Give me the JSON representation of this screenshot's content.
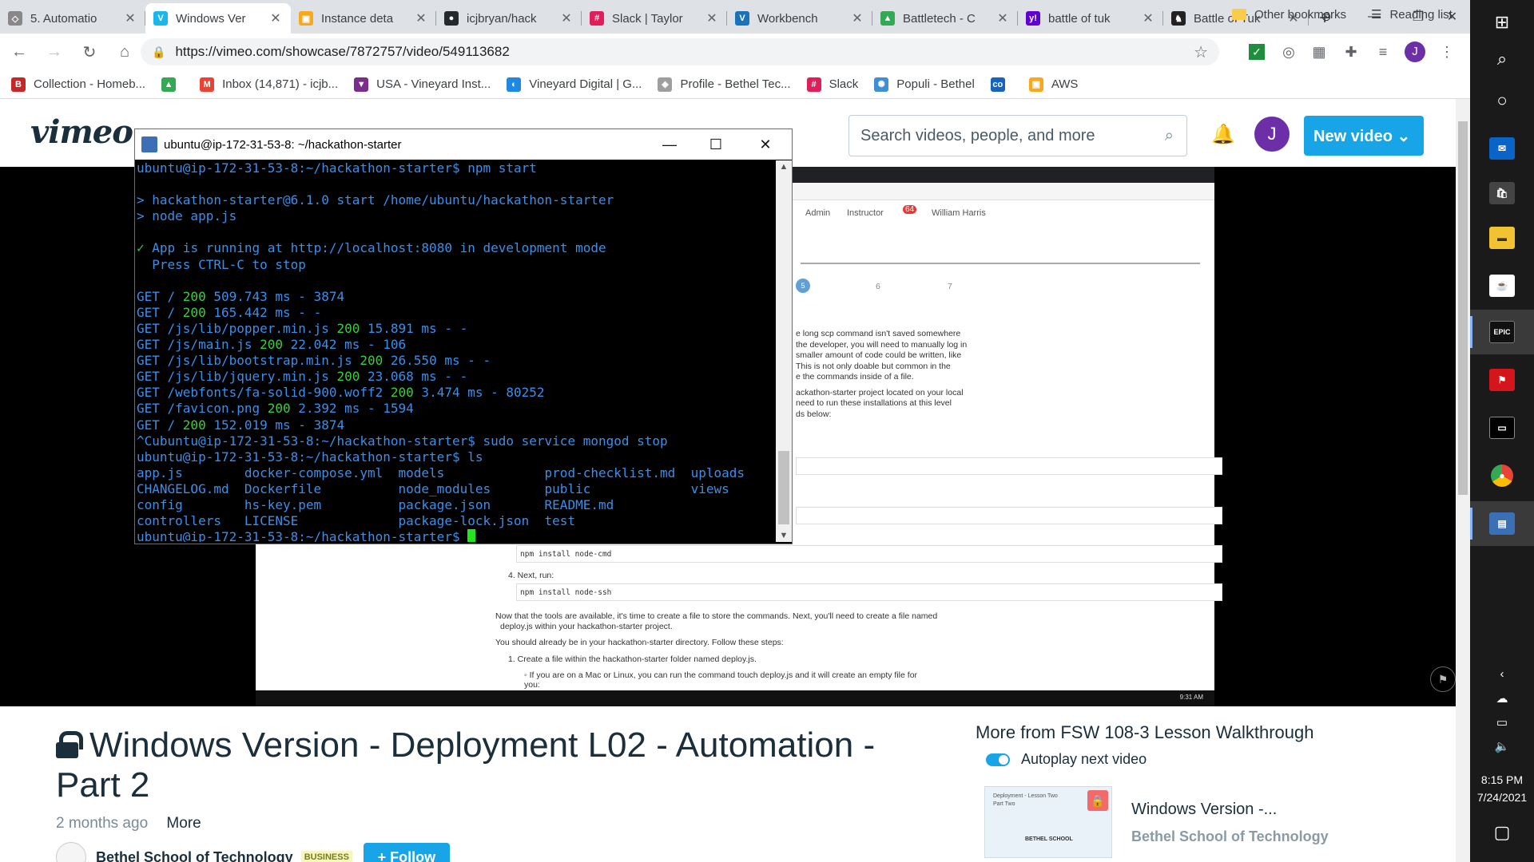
{
  "browser": {
    "tabs": [
      {
        "title": "5. Automatio",
        "fav_color": "#888888",
        "fav_glyph": "◇"
      },
      {
        "title": "Windows Ver",
        "fav_color": "#1ab7ea",
        "fav_glyph": "V",
        "active": true
      },
      {
        "title": "Instance deta",
        "fav_color": "#f7a81b",
        "fav_glyph": "▣"
      },
      {
        "title": "icjbryan/hack",
        "fav_color": "#24292e",
        "fav_glyph": "●"
      },
      {
        "title": "Slack | Taylor",
        "fav_color": "#e01e5a",
        "fav_glyph": "#"
      },
      {
        "title": "Workbench",
        "fav_color": "#1a73b8",
        "fav_glyph": "V"
      },
      {
        "title": "Battletech - C",
        "fav_color": "#34a853",
        "fav_glyph": "▲"
      },
      {
        "title": "battle of tuk",
        "fav_color": "#6001d2",
        "fav_glyph": "y!"
      },
      {
        "title": "Battle of Tuk",
        "fav_color": "#222222",
        "fav_glyph": "♞"
      }
    ],
    "url": "https://vimeo.com/showcase/7872757/video/549113682",
    "bookmarks": [
      {
        "label": "Collection - Homeb...",
        "color": "#c62828",
        "glyph": "B"
      },
      {
        "label": "",
        "color": "#34a853",
        "glyph": "▲"
      },
      {
        "label": "Inbox (14,871) - icjb...",
        "color": "#ea4335",
        "glyph": "M"
      },
      {
        "label": "USA - Vineyard Inst...",
        "color": "#7b2d8e",
        "glyph": "▼"
      },
      {
        "label": "Vineyard Digital | G...",
        "color": "#1e88e5",
        "glyph": "◐"
      },
      {
        "label": "Profile - Bethel Tec...",
        "color": "#9e9e9e",
        "glyph": "◈"
      },
      {
        "label": "Slack",
        "color": "#e01e5a",
        "glyph": "#"
      },
      {
        "label": "Populi - Bethel",
        "color": "#3f8fd2",
        "glyph": "✺"
      },
      {
        "label": "",
        "color": "#1565c0",
        "glyph": "co"
      },
      {
        "label": "AWS",
        "color": "#f7a81b",
        "glyph": "▣"
      }
    ],
    "other_bookmarks": "Other bookmarks",
    "reading_list": "Reading list"
  },
  "vimeo": {
    "logo": "vimeo",
    "search_placeholder": "Search videos, people, and more",
    "avatar_letter": "J",
    "new_video_label": "New video ⌄",
    "video_title": "Windows Version - Deployment L02 - Automation - Part 2",
    "posted": "2 months ago",
    "more": "More",
    "channel_name": "Bethel School of Technology",
    "channel_badge": "BUSINESS",
    "follow_label": "+ Follow",
    "sidebar_title": "More from FSW 108-3 Lesson Walkthrough",
    "autoplay_label": "Autoplay next video",
    "related_title": "Windows Version -...",
    "related_channel": "Bethel School of Technology",
    "thumb_top": "Deployment - Lesson Two",
    "thumb_part": "Part Two",
    "thumb_brand": "BETHEL SCHOOL"
  },
  "inner_page": {
    "nav": [
      "Admin",
      "Instructor",
      "William Harris"
    ],
    "notif_count": "64",
    "steps": [
      "5",
      "6",
      "7"
    ],
    "paragraph_lines": [
      "e long scp command isn't saved somewhere",
      "the developer, you will need to manually log in",
      "smaller amount of code could be written, like",
      "This is not only doable but common in the",
      "e the commands inside of a file.",
      "ackathon-starter project located on your local",
      "need to run these installations at this level",
      "ds below:"
    ],
    "code1": "npm install node-cmd",
    "step4": "4. Next, run:",
    "code2": "npm install node-ssh",
    "lower_lines": [
      "Now that the tools are available, it's time to create a file to store the commands. Next, you'll need to create a file named",
      "deploy.js within your hackathon-starter project.",
      "You should already be in your hackathon-starter directory. Follow these steps:",
      "1. Create a file within the hackathon-starter folder named deploy.js.",
      "◦ If you are on a Mac or Linux, you can run the command touch deploy.js and it will create an empty file for",
      "you:"
    ],
    "time": "9:31 AM"
  },
  "terminal": {
    "title": "ubuntu@ip-172-31-53-8: ~/hackathon-starter",
    "prompt": "ubuntu@ip-172-31-53-8:~/hackathon-starter$",
    "lines": [
      {
        "t": "ubuntu@ip-172-31-53-8:~/hackathon-starter$ npm start"
      },
      {
        "t": ""
      },
      {
        "t": "> hackathon-starter@6.1.0 start /home/ubuntu/hackathon-starter"
      },
      {
        "t": "> node app.js"
      },
      {
        "t": ""
      },
      {
        "pre": "✓",
        "t": " App is running at http://localhost:8080 in development mode"
      },
      {
        "t": "  Press CTRL-C to stop"
      },
      {
        "t": ""
      },
      {
        "a": "GET / ",
        "s": "200",
        "b": " 509.743 ms - 3874"
      },
      {
        "a": "GET / ",
        "s": "200",
        "b": " 165.442 ms - -"
      },
      {
        "a": "GET /js/lib/popper.min.js ",
        "s": "200",
        "b": " 15.891 ms - -"
      },
      {
        "a": "GET /js/main.js ",
        "s": "200",
        "b": " 22.042 ms - 106"
      },
      {
        "a": "GET /js/lib/bootstrap.min.js ",
        "s": "200",
        "b": " 26.550 ms - -"
      },
      {
        "a": "GET /js/lib/jquery.min.js ",
        "s": "200",
        "b": " 23.068 ms - -"
      },
      {
        "a": "GET /webfonts/fa-solid-900.woff2 ",
        "s": "200",
        "b": " 3.474 ms - 80252"
      },
      {
        "a": "GET /favicon.png ",
        "s": "200",
        "b": " 2.392 ms - 1594"
      },
      {
        "a": "GET / ",
        "s": "200",
        "b": " 152.019 ms - 3874"
      },
      {
        "t": "^Cubuntu@ip-172-31-53-8:~/hackathon-starter$ sudo service mongod stop"
      },
      {
        "t": "ubuntu@ip-172-31-53-8:~/hackathon-starter$ ls"
      },
      {
        "t": "app.js        docker-compose.yml  models             prod-checklist.md  uploads"
      },
      {
        "t": "CHANGELOG.md  Dockerfile          node_modules       public             views"
      },
      {
        "t": "config        hs-key.pem          package.json       README.md"
      },
      {
        "t": "controllers   LICENSE             package-lock.json  test"
      }
    ]
  },
  "windows": {
    "time": "8:15 PM",
    "date": "7/24/2021"
  }
}
